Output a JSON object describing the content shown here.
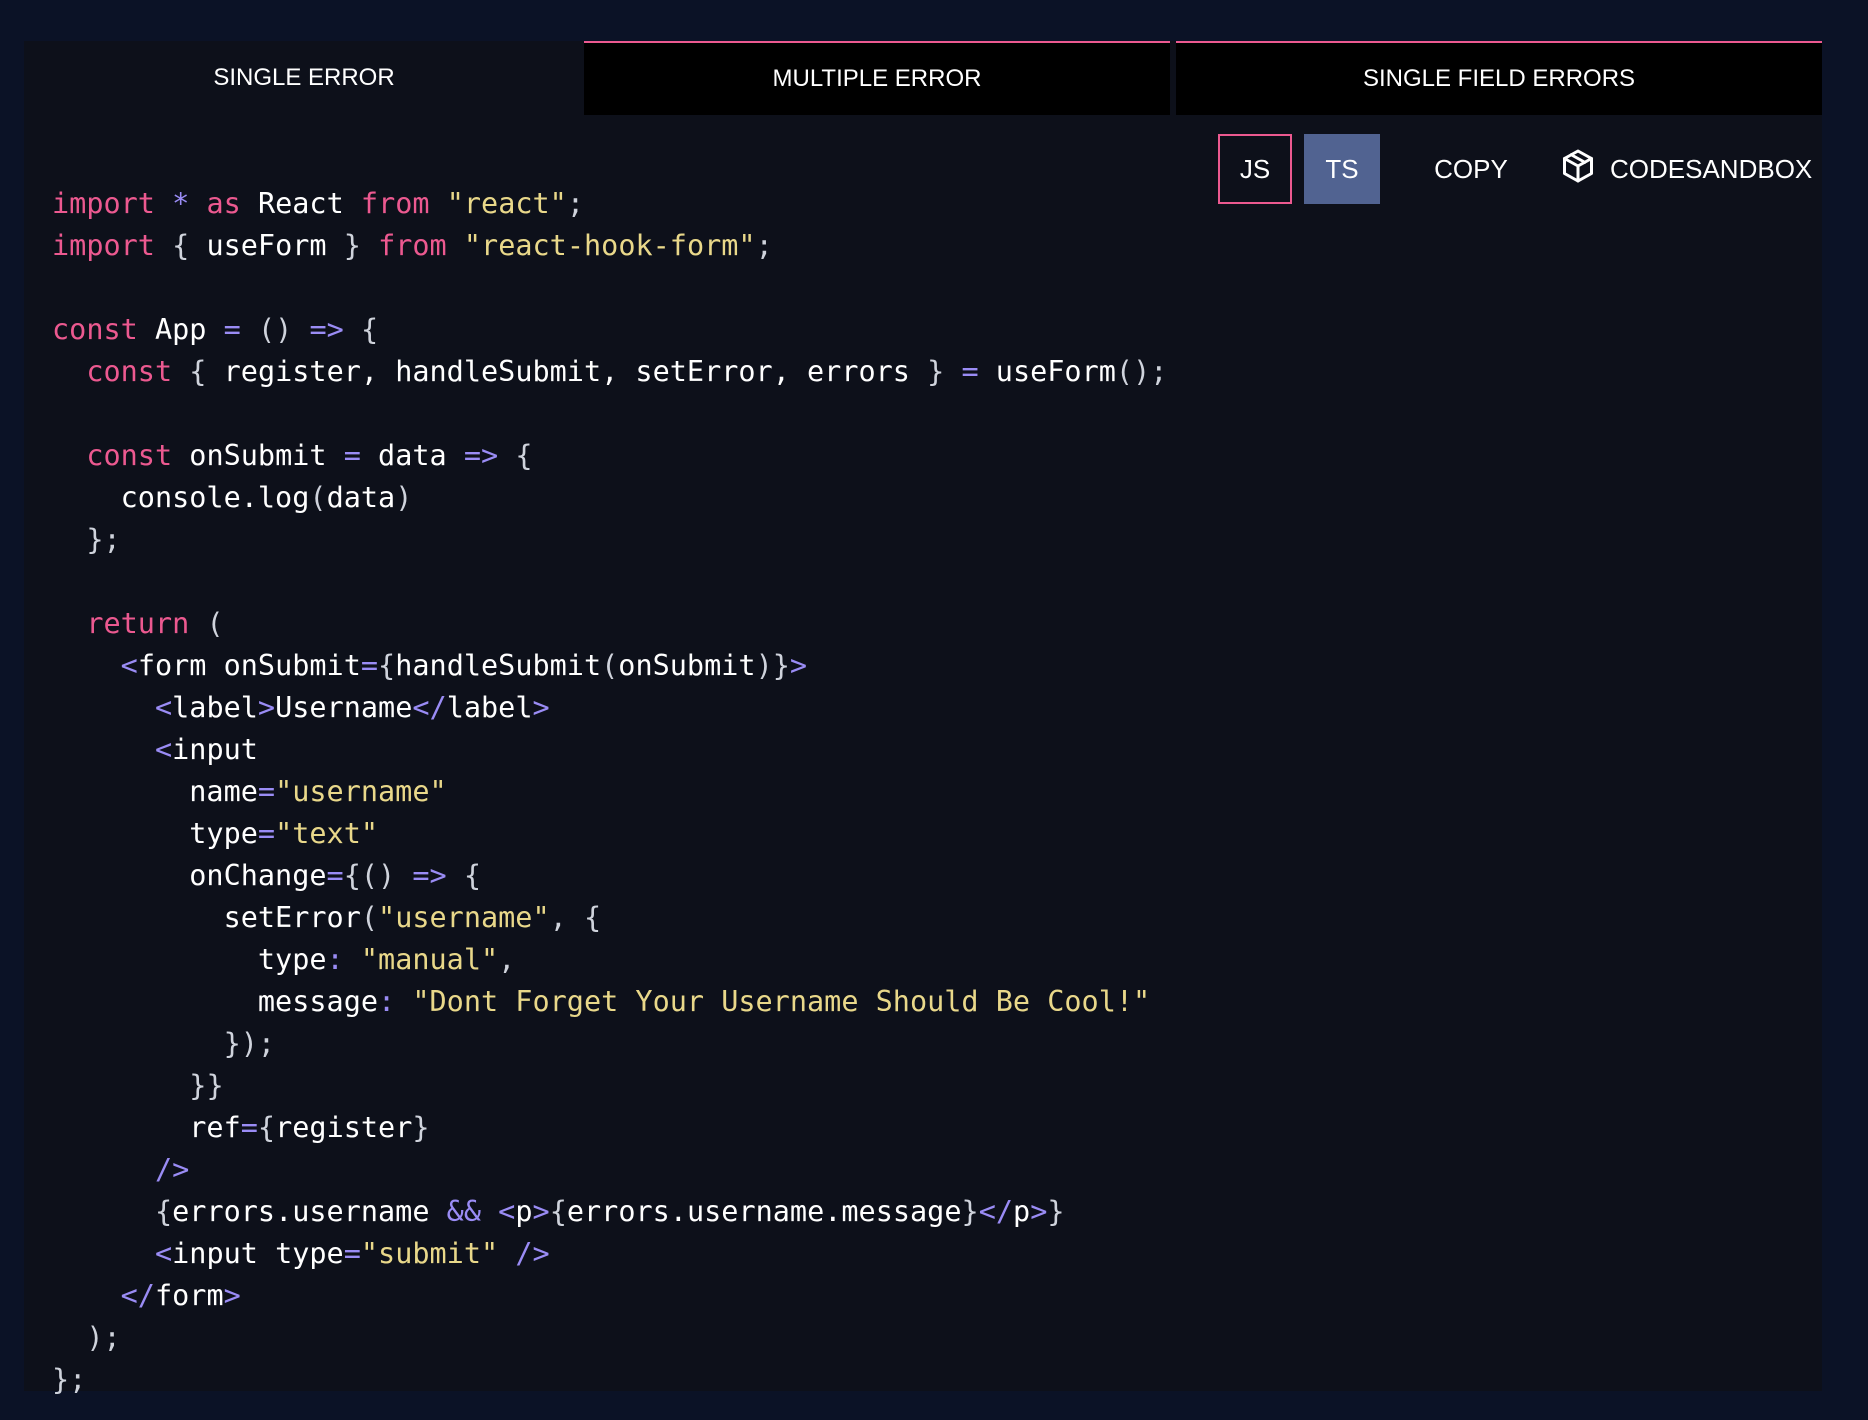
{
  "tabs": [
    {
      "label": "SINGLE ERROR",
      "active": true
    },
    {
      "label": "MULTIPLE ERROR",
      "active": false
    },
    {
      "label": "SINGLE FIELD ERRORS",
      "active": false
    }
  ],
  "toolbar": {
    "js_label": "JS",
    "ts_label": "TS",
    "copy_label": "COPY",
    "codesandbox_label": "CODESANDBOX",
    "codesandbox_icon": "cube-icon"
  },
  "colors": {
    "page_bg": "#0b1226",
    "panel_bg": "#0d101a",
    "keyword": "#ec5990",
    "string": "#e9d88a",
    "operator": "#9a8cf5",
    "active_lang_bg": "#516391"
  },
  "code_lines": [
    [
      {
        "t": "import",
        "c": "k"
      },
      {
        "t": " "
      },
      {
        "t": "*",
        "c": "o"
      },
      {
        "t": " "
      },
      {
        "t": "as",
        "c": "k"
      },
      {
        "t": " React "
      },
      {
        "t": "from",
        "c": "k"
      },
      {
        "t": " "
      },
      {
        "t": "\"react\"",
        "c": "s"
      },
      {
        "t": ";",
        "c": "p"
      }
    ],
    [
      {
        "t": "import",
        "c": "k"
      },
      {
        "t": " "
      },
      {
        "t": "{",
        "c": "p"
      },
      {
        "t": " useForm "
      },
      {
        "t": "}",
        "c": "p"
      },
      {
        "t": " "
      },
      {
        "t": "from",
        "c": "k"
      },
      {
        "t": " "
      },
      {
        "t": "\"react-hook-form\"",
        "c": "s"
      },
      {
        "t": ";",
        "c": "p"
      }
    ],
    [],
    [
      {
        "t": "const",
        "c": "k"
      },
      {
        "t": " App "
      },
      {
        "t": "=",
        "c": "o"
      },
      {
        "t": " "
      },
      {
        "t": "()",
        "c": "p"
      },
      {
        "t": " "
      },
      {
        "t": "=>",
        "c": "o"
      },
      {
        "t": " "
      },
      {
        "t": "{",
        "c": "p"
      }
    ],
    [
      {
        "t": "  "
      },
      {
        "t": "const",
        "c": "k"
      },
      {
        "t": " "
      },
      {
        "t": "{",
        "c": "p"
      },
      {
        "t": " register, handleSubmit, setError, errors "
      },
      {
        "t": "}",
        "c": "p"
      },
      {
        "t": " "
      },
      {
        "t": "=",
        "c": "o"
      },
      {
        "t": " useForm"
      },
      {
        "t": "();",
        "c": "p"
      }
    ],
    [],
    [
      {
        "t": "  "
      },
      {
        "t": "const",
        "c": "k"
      },
      {
        "t": " onSubmit "
      },
      {
        "t": "=",
        "c": "o"
      },
      {
        "t": " data "
      },
      {
        "t": "=>",
        "c": "o"
      },
      {
        "t": " "
      },
      {
        "t": "{",
        "c": "p"
      }
    ],
    [
      {
        "t": "    console.log"
      },
      {
        "t": "(",
        "c": "p"
      },
      {
        "t": "data"
      },
      {
        "t": ")",
        "c": "p"
      }
    ],
    [
      {
        "t": "  "
      },
      {
        "t": "};",
        "c": "p"
      }
    ],
    [],
    [
      {
        "t": "  "
      },
      {
        "t": "return",
        "c": "k"
      },
      {
        "t": " "
      },
      {
        "t": "(",
        "c": "p"
      }
    ],
    [
      {
        "t": "    "
      },
      {
        "t": "<",
        "c": "o"
      },
      {
        "t": "form onSubmit"
      },
      {
        "t": "=",
        "c": "o"
      },
      {
        "t": "{",
        "c": "p"
      },
      {
        "t": "handleSubmit"
      },
      {
        "t": "(",
        "c": "p"
      },
      {
        "t": "onSubmit"
      },
      {
        "t": ")}",
        "c": "p"
      },
      {
        "t": ">",
        "c": "o"
      }
    ],
    [
      {
        "t": "      "
      },
      {
        "t": "<",
        "c": "o"
      },
      {
        "t": "label"
      },
      {
        "t": ">",
        "c": "o"
      },
      {
        "t": "Username"
      },
      {
        "t": "</",
        "c": "o"
      },
      {
        "t": "label"
      },
      {
        "t": ">",
        "c": "o"
      }
    ],
    [
      {
        "t": "      "
      },
      {
        "t": "<",
        "c": "o"
      },
      {
        "t": "input"
      }
    ],
    [
      {
        "t": "        name"
      },
      {
        "t": "=",
        "c": "o"
      },
      {
        "t": "\"username\"",
        "c": "s"
      }
    ],
    [
      {
        "t": "        type"
      },
      {
        "t": "=",
        "c": "o"
      },
      {
        "t": "\"text\"",
        "c": "s"
      }
    ],
    [
      {
        "t": "        onChange"
      },
      {
        "t": "=",
        "c": "o"
      },
      {
        "t": "{()",
        "c": "p"
      },
      {
        "t": " "
      },
      {
        "t": "=>",
        "c": "o"
      },
      {
        "t": " "
      },
      {
        "t": "{",
        "c": "p"
      }
    ],
    [
      {
        "t": "          setError"
      },
      {
        "t": "(",
        "c": "p"
      },
      {
        "t": "\"username\"",
        "c": "s"
      },
      {
        "t": ",",
        "c": "p"
      },
      {
        "t": " "
      },
      {
        "t": "{",
        "c": "p"
      }
    ],
    [
      {
        "t": "            type"
      },
      {
        "t": ":",
        "c": "o"
      },
      {
        "t": " "
      },
      {
        "t": "\"manual\"",
        "c": "s"
      },
      {
        "t": ",",
        "c": "p"
      }
    ],
    [
      {
        "t": "            message"
      },
      {
        "t": ":",
        "c": "o"
      },
      {
        "t": " "
      },
      {
        "t": "\"Dont Forget Your Username Should Be Cool!\"",
        "c": "s"
      }
    ],
    [
      {
        "t": "          "
      },
      {
        "t": "});",
        "c": "p"
      }
    ],
    [
      {
        "t": "        "
      },
      {
        "t": "}}",
        "c": "p"
      }
    ],
    [
      {
        "t": "        ref"
      },
      {
        "t": "=",
        "c": "o"
      },
      {
        "t": "{",
        "c": "p"
      },
      {
        "t": "register"
      },
      {
        "t": "}",
        "c": "p"
      }
    ],
    [
      {
        "t": "      "
      },
      {
        "t": "/>",
        "c": "o"
      }
    ],
    [
      {
        "t": "      "
      },
      {
        "t": "{",
        "c": "p"
      },
      {
        "t": "errors.username "
      },
      {
        "t": "&&",
        "c": "o"
      },
      {
        "t": " "
      },
      {
        "t": "<",
        "c": "o"
      },
      {
        "t": "p"
      },
      {
        "t": ">",
        "c": "o"
      },
      {
        "t": "{",
        "c": "p"
      },
      {
        "t": "errors.username.message"
      },
      {
        "t": "}",
        "c": "p"
      },
      {
        "t": "</",
        "c": "o"
      },
      {
        "t": "p"
      },
      {
        "t": ">",
        "c": "o"
      },
      {
        "t": "}",
        "c": "p"
      }
    ],
    [
      {
        "t": "      "
      },
      {
        "t": "<",
        "c": "o"
      },
      {
        "t": "input type"
      },
      {
        "t": "=",
        "c": "o"
      },
      {
        "t": "\"submit\"",
        "c": "s"
      },
      {
        "t": " "
      },
      {
        "t": "/>",
        "c": "o"
      }
    ],
    [
      {
        "t": "    "
      },
      {
        "t": "</",
        "c": "o"
      },
      {
        "t": "form"
      },
      {
        "t": ">",
        "c": "o"
      }
    ],
    [
      {
        "t": "  "
      },
      {
        "t": ");",
        "c": "p"
      }
    ],
    [
      {
        "t": "};",
        "c": "p"
      }
    ]
  ]
}
